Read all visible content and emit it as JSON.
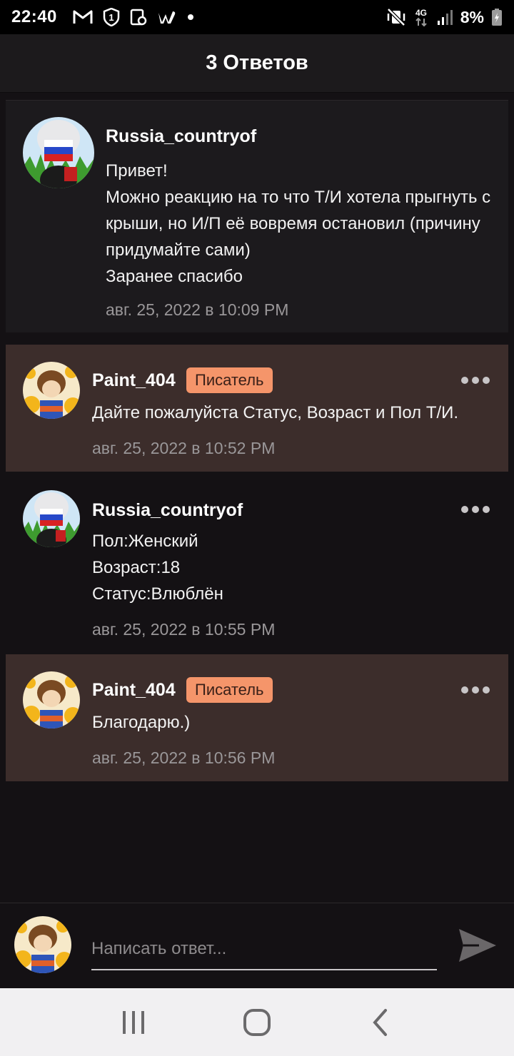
{
  "status_bar": {
    "time": "22:40",
    "network": "4G",
    "battery": "8%",
    "left_icons": [
      "gmail-icon",
      "one-icon",
      "app-icon",
      "wattpad-icon",
      "dot-icon"
    ],
    "right_icons": [
      "mute-vibrate-icon",
      "network-icon",
      "signal-icon",
      "battery-icon"
    ]
  },
  "header": {
    "title": "3 Ответов"
  },
  "main_comment": {
    "author": "Russia_countryof",
    "text": "Привет!\nМожно реакцию на то что Т/И хотела прыгнуть с крыши, но И/П её вовремя остановил (причину придумайте сами)\nЗаранее спасибо",
    "date": "авг. 25, 2022 в 10:09 PM"
  },
  "replies": [
    {
      "author": "Paint_404",
      "badge": "Писатель",
      "text": "Дайте пожалуйста Статус, Возраст и Пол Т/И.",
      "date": "авг. 25, 2022 в 10:52 PM"
    },
    {
      "author": "Russia_countryof",
      "badge": "",
      "text": "Пол:Женский\nВозраст:18\nСтатус:Влюблён",
      "date": "авг. 25, 2022 в 10:55 PM"
    },
    {
      "author": "Paint_404",
      "badge": "Писатель",
      "text": "Благодарю.)",
      "date": "авг. 25, 2022 в 10:56 PM"
    }
  ],
  "input": {
    "placeholder": "Написать ответ..."
  },
  "colors": {
    "background": "#141114",
    "highlight": "#3c2d2b",
    "badge": "#f5956a",
    "muted_text": "#9a9799"
  }
}
